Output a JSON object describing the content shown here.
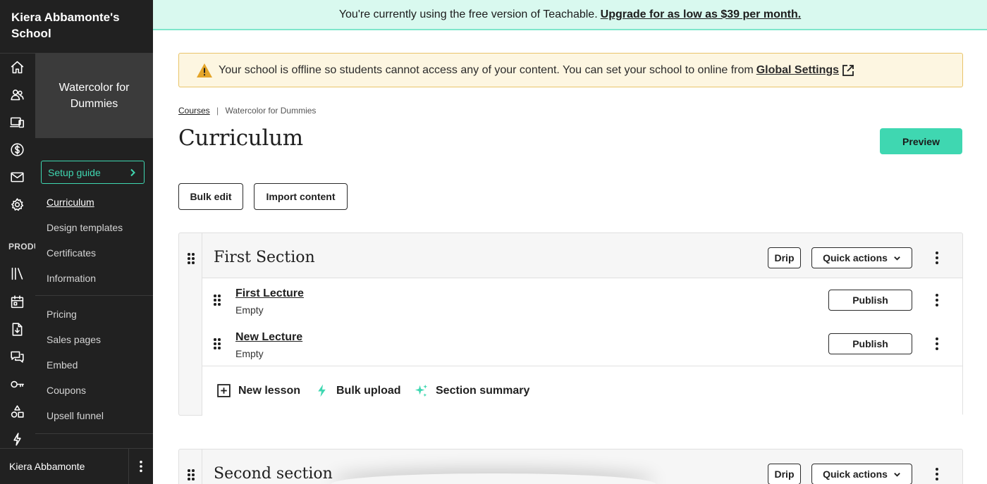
{
  "sidebar": {
    "school_name": "Kiera Abbamonte's School",
    "rail_icons": [
      "home-icon",
      "users-icon",
      "devices-icon",
      "dollar-icon",
      "mail-icon",
      "gear-icon",
      "library-icon",
      "calendar-icon",
      "download-icon",
      "chat-icon",
      "key-icon",
      "shapes-icon",
      "lightning-icon"
    ],
    "rail_section_label": "PRODUCTS",
    "course_title": "Watercolor for Dummies",
    "setup_guide": "Setup guide",
    "nav_primary": [
      "Curriculum",
      "Design templates",
      "Certificates",
      "Information"
    ],
    "nav_secondary": [
      "Pricing",
      "Sales pages",
      "Embed",
      "Coupons",
      "Upsell funnel"
    ],
    "active_item": "Curriculum",
    "user_name": "Kiera Abbamonte"
  },
  "banner": {
    "text": "You're currently using the free version of Teachable.",
    "link": "Upgrade for as low as $39 per month."
  },
  "warning": {
    "text": "Your school is offline so students cannot access any of your content. You can set your school to online from",
    "link": "Global Settings"
  },
  "breadcrumb": {
    "root": "Courses",
    "separator": "|",
    "current": "Watercolor for Dummies"
  },
  "page": {
    "title": "Curriculum",
    "preview": "Preview",
    "bulk_edit": "Bulk edit",
    "import_content": "Import content"
  },
  "sections": [
    {
      "title": "First Section",
      "drip": "Drip",
      "quick_actions": "Quick actions",
      "lectures": [
        {
          "title": "First Lecture",
          "status": "Empty",
          "publish": "Publish"
        },
        {
          "title": "New Lecture",
          "status": "Empty",
          "publish": "Publish"
        }
      ],
      "actions": {
        "new_lesson": "New lesson",
        "bulk_upload": "Bulk upload",
        "section_summary": "Section summary"
      }
    },
    {
      "title": "Second section",
      "drip": "Drip",
      "quick_actions": "Quick actions"
    }
  ],
  "colors": {
    "accent": "#3fd7b1",
    "sidebar_bg": "#212121",
    "banner_bg": "#d9f9ef",
    "warning_bg": "#fdf6e1",
    "warning_icon": "#e4a52a"
  }
}
